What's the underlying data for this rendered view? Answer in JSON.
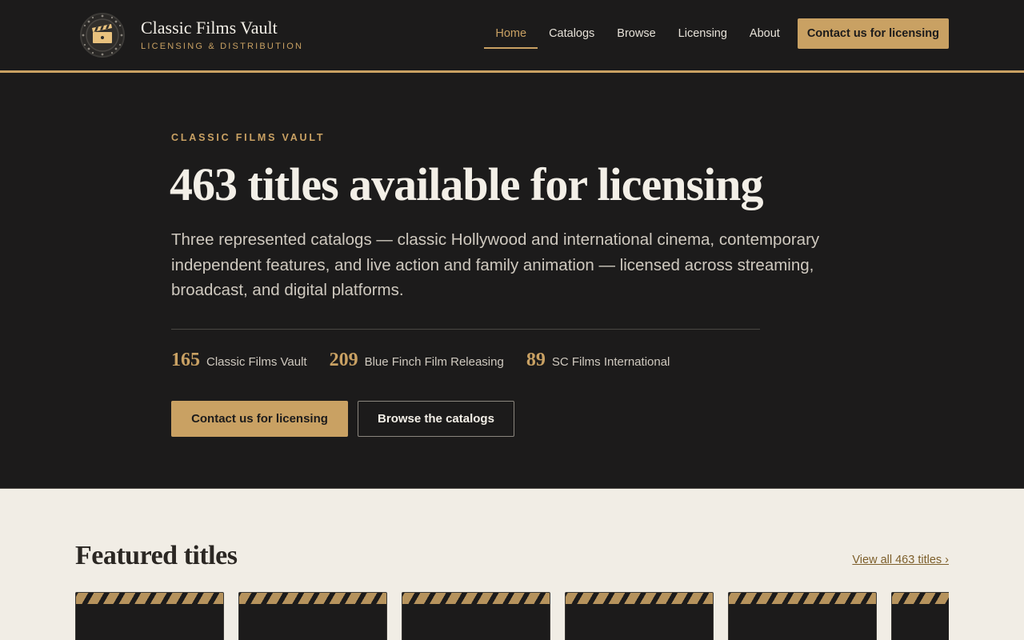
{
  "brand": {
    "title": "Classic Films Vault",
    "subtitle": "LICENSING & DISTRIBUTION",
    "logo_icon": "film-clapperboard-reel-icon"
  },
  "nav": {
    "items": [
      {
        "label": "Home",
        "active": true
      },
      {
        "label": "Catalogs",
        "active": false
      },
      {
        "label": "Browse",
        "active": false
      },
      {
        "label": "Licensing",
        "active": false
      },
      {
        "label": "About",
        "active": false
      }
    ],
    "cta_label": "Contact us for licensing"
  },
  "hero": {
    "eyebrow": "CLASSIC FILMS VAULT",
    "title": "463 titles available for licensing",
    "description": "Three represented catalogs — classic Hollywood and international cinema, contemporary independent features, and live action and family animation — licensed across streaming, broadcast, and digital platforms.",
    "stats": [
      {
        "count": "165",
        "label": "Classic Films Vault"
      },
      {
        "count": "209",
        "label": "Blue Finch Film Releasing"
      },
      {
        "count": "89",
        "label": "SC Films International"
      }
    ],
    "primary_button": "Contact us for licensing",
    "secondary_button": "Browse the catalogs"
  },
  "featured": {
    "title": "Featured titles",
    "view_all": "View all 463 titles ›",
    "card_count": 6
  },
  "colors": {
    "accent": "#c9a163",
    "dark": "#1c1b1b",
    "light_bg": "#f1ede5",
    "link": "#7d5f2b"
  }
}
